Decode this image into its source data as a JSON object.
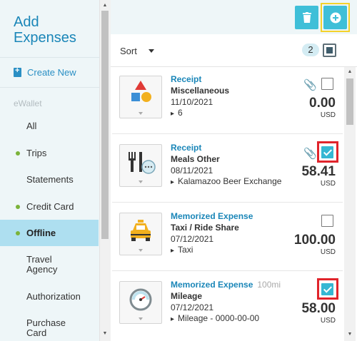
{
  "sidebar": {
    "title": "Add Expenses",
    "create_new": "Create New",
    "section_label": "eWallet",
    "items": [
      {
        "label": "All"
      },
      {
        "label": "Trips"
      },
      {
        "label": "Statements"
      },
      {
        "label": "Credit Card"
      },
      {
        "label": "Offline"
      },
      {
        "label": "Travel Agency"
      },
      {
        "label": "Authorization"
      },
      {
        "label": "Purchase Card"
      }
    ]
  },
  "toolbar": {
    "delete_icon": "trash-icon",
    "add_icon": "plus-circle-icon"
  },
  "sort": {
    "label": "Sort",
    "selected_count": "2"
  },
  "expenses": [
    {
      "type": "Receipt",
      "extra": "",
      "category": "Miscellaneous",
      "date": "11/10/2021",
      "merchant": "6",
      "amount": "0.00",
      "currency": "USD",
      "attachment": true,
      "checked": false
    },
    {
      "type": "Receipt",
      "extra": "",
      "category": "Meals Other",
      "date": "08/11/2021",
      "merchant": "Kalamazoo Beer Exchange",
      "amount": "58.41",
      "currency": "USD",
      "attachment": true,
      "checked": true
    },
    {
      "type": "Memorized Expense",
      "extra": "",
      "category": "Taxi / Ride Share",
      "date": "07/12/2021",
      "merchant": "Taxi",
      "amount": "100.00",
      "currency": "USD",
      "attachment": false,
      "checked": false
    },
    {
      "type": "Memorized Expense",
      "extra": "100mi",
      "category": "Mileage",
      "date": "07/12/2021",
      "merchant": "Mileage - 0000-00-00",
      "amount": "58.00",
      "currency": "USD",
      "attachment": false,
      "checked": true
    }
  ],
  "colors": {
    "accent": "#1a86b8",
    "button": "#3fbfd8",
    "highlight_yellow": "#f4d22b",
    "highlight_red": "#e0242b",
    "active_nav": "#aedff0",
    "status_dot": "#7bb33a"
  }
}
